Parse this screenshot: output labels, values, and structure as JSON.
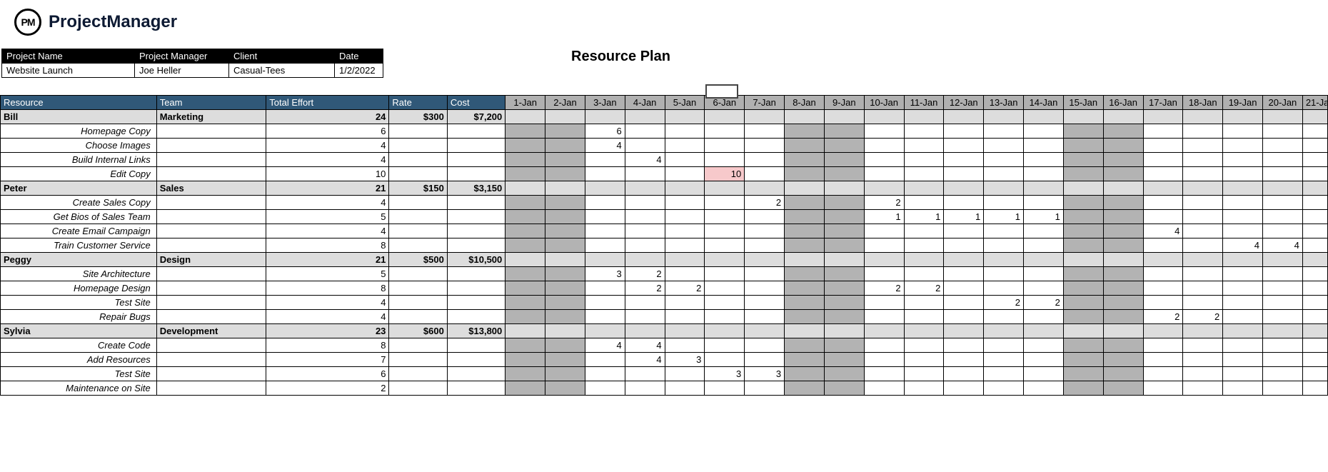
{
  "brand": {
    "badge": "PM",
    "name": "ProjectManager"
  },
  "title": "Resource Plan",
  "meta": {
    "headers": [
      "Project Name",
      "Project Manager",
      "Client",
      "Date"
    ],
    "values": [
      "Website Launch",
      "Joe Heller",
      "Casual-Tees",
      "1/2/2022"
    ]
  },
  "columns": {
    "resource": "Resource",
    "team": "Team",
    "effort": "Total Effort",
    "rate": "Rate",
    "cost": "Cost"
  },
  "days": [
    "1-Jan",
    "2-Jan",
    "3-Jan",
    "4-Jan",
    "5-Jan",
    "6-Jan",
    "7-Jan",
    "8-Jan",
    "9-Jan",
    "10-Jan",
    "11-Jan",
    "12-Jan",
    "13-Jan",
    "14-Jan",
    "15-Jan",
    "16-Jan",
    "17-Jan",
    "18-Jan",
    "19-Jan",
    "20-Jan",
    "21-Ja"
  ],
  "weekend_idx": [
    0,
    1,
    7,
    8,
    14,
    15
  ],
  "groups": [
    {
      "name": "Bill",
      "team": "Marketing",
      "effort": "24",
      "rate": "$300",
      "cost": "$7,200",
      "tasks": [
        {
          "name": "Homepage Copy",
          "effort": "6",
          "cells": {
            "2": "6"
          }
        },
        {
          "name": "Choose Images",
          "effort": "4",
          "cells": {
            "2": "4"
          }
        },
        {
          "name": "Build Internal Links",
          "effort": "4",
          "cells": {
            "3": "4"
          }
        },
        {
          "name": "Edit Copy",
          "effort": "10",
          "cells": {
            "5": "10"
          },
          "highlight": [
            "5"
          ]
        }
      ]
    },
    {
      "name": "Peter",
      "team": "Sales",
      "effort": "21",
      "rate": "$150",
      "cost": "$3,150",
      "tasks": [
        {
          "name": "Create Sales Copy",
          "effort": "4",
          "cells": {
            "6": "2",
            "9": "2"
          }
        },
        {
          "name": "Get Bios of Sales Team",
          "effort": "5",
          "cells": {
            "9": "1",
            "10": "1",
            "11": "1",
            "12": "1",
            "13": "1"
          }
        },
        {
          "name": "Create Email Campaign",
          "effort": "4",
          "cells": {
            "16": "4"
          }
        },
        {
          "name": "Train Customer Service",
          "effort": "8",
          "cells": {
            "18": "4",
            "19": "4"
          }
        }
      ]
    },
    {
      "name": "Peggy",
      "team": "Design",
      "effort": "21",
      "rate": "$500",
      "cost": "$10,500",
      "tasks": [
        {
          "name": "Site Architecture",
          "effort": "5",
          "cells": {
            "2": "3",
            "3": "2"
          }
        },
        {
          "name": "Homepage Design",
          "effort": "8",
          "cells": {
            "3": "2",
            "4": "2",
            "9": "2",
            "10": "2"
          }
        },
        {
          "name": "Test Site",
          "effort": "4",
          "cells": {
            "12": "2",
            "13": "2"
          }
        },
        {
          "name": "Repair Bugs",
          "effort": "4",
          "cells": {
            "16": "2",
            "17": "2"
          }
        }
      ]
    },
    {
      "name": "Sylvia",
      "team": "Development",
      "effort": "23",
      "rate": "$600",
      "cost": "$13,800",
      "tasks": [
        {
          "name": "Create Code",
          "effort": "8",
          "cells": {
            "2": "4",
            "3": "4"
          }
        },
        {
          "name": "Add Resources",
          "effort": "7",
          "cells": {
            "3": "4",
            "4": "3"
          }
        },
        {
          "name": "Test Site",
          "effort": "6",
          "cells": {
            "5": "3",
            "6": "3"
          }
        },
        {
          "name": "Maintenance on Site",
          "effort": "2",
          "cells": {}
        }
      ]
    }
  ]
}
